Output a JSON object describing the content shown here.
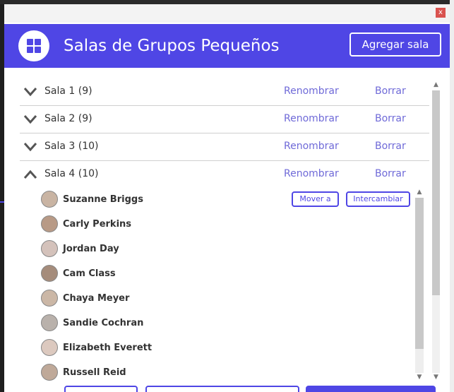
{
  "window": {
    "close_glyph": "x"
  },
  "header": {
    "title": "Salas de Grupos Pequeños",
    "add_room_label": "Agregar sala",
    "app_icon": "grid-icon",
    "accent_color": "#4f46e5"
  },
  "rooms": [
    {
      "name": "Sala 1 (9)",
      "rename": "Renombrar",
      "delete": "Borrar",
      "expanded": false
    },
    {
      "name": "Sala 2 (9)",
      "rename": "Renombrar",
      "delete": "Borrar",
      "expanded": false
    },
    {
      "name": "Sala 3 (10)",
      "rename": "Renombrar",
      "delete": "Borrar",
      "expanded": false
    },
    {
      "name": "Sala 4 (10)",
      "rename": "Renombrar",
      "delete": "Borrar",
      "expanded": true
    }
  ],
  "participants": [
    {
      "name": "Suzanne Briggs"
    },
    {
      "name": "Carly Perkins"
    },
    {
      "name": "Jordan Day"
    },
    {
      "name": "Cam Class"
    },
    {
      "name": "Chaya Meyer"
    },
    {
      "name": "Sandie Cochran"
    },
    {
      "name": "Elizabeth Everett"
    },
    {
      "name": "Russell Reid"
    }
  ],
  "participant_actions": {
    "move_label": "Mover a",
    "swap_label": "Intercambiar"
  }
}
